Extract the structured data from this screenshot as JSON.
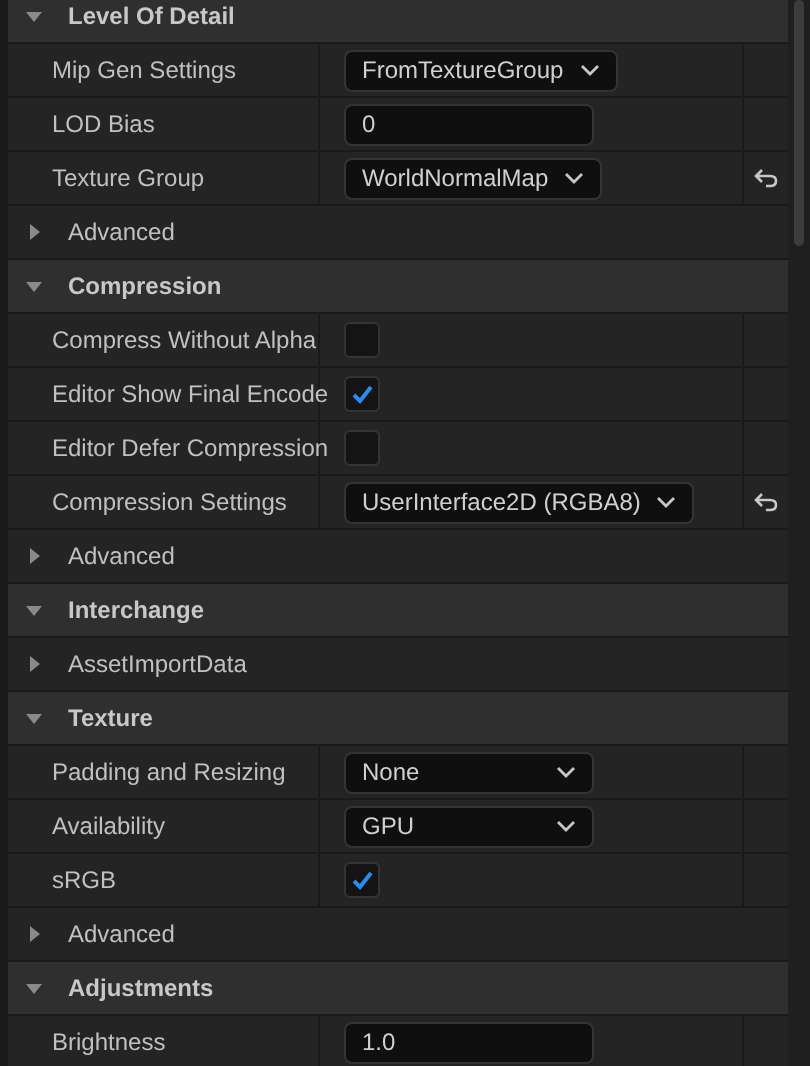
{
  "sections": [
    {
      "title": "Level Of Detail",
      "expanded": true,
      "rows": [
        {
          "kind": "dropdown",
          "label": "Mip Gen Settings",
          "value": "FromTextureGroup",
          "reset": false
        },
        {
          "kind": "number",
          "label": "LOD Bias",
          "value": "0",
          "reset": false
        },
        {
          "kind": "dropdown",
          "label": "Texture Group",
          "value": "WorldNormalMap",
          "reset": true
        },
        {
          "kind": "group",
          "label": "Advanced",
          "expanded": false
        }
      ]
    },
    {
      "title": "Compression",
      "expanded": true,
      "rows": [
        {
          "kind": "checkbox",
          "label": "Compress Without Alpha",
          "checked": false,
          "reset": false
        },
        {
          "kind": "checkbox",
          "label": "Editor Show Final Encode",
          "checked": true,
          "reset": false
        },
        {
          "kind": "checkbox",
          "label": "Editor Defer Compression",
          "checked": false,
          "reset": false
        },
        {
          "kind": "dropdown",
          "label": "Compression Settings",
          "value": "UserInterface2D (RGBA8)",
          "reset": true
        },
        {
          "kind": "group",
          "label": "Advanced",
          "expanded": false
        }
      ]
    },
    {
      "title": "Interchange",
      "expanded": true,
      "rows": [
        {
          "kind": "group",
          "label": "AssetImportData",
          "expanded": false
        }
      ]
    },
    {
      "title": "Texture",
      "expanded": true,
      "rows": [
        {
          "kind": "dropdown",
          "label": "Padding and Resizing",
          "value": "None",
          "reset": false
        },
        {
          "kind": "dropdown",
          "label": "Availability",
          "value": "GPU",
          "reset": false
        },
        {
          "kind": "checkbox",
          "label": "sRGB",
          "checked": true,
          "reset": false
        },
        {
          "kind": "group",
          "label": "Advanced",
          "expanded": false
        }
      ]
    },
    {
      "title": "Adjustments",
      "expanded": true,
      "rows": [
        {
          "kind": "number",
          "label": "Brightness",
          "value": "1.0",
          "reset": false
        }
      ]
    }
  ]
}
